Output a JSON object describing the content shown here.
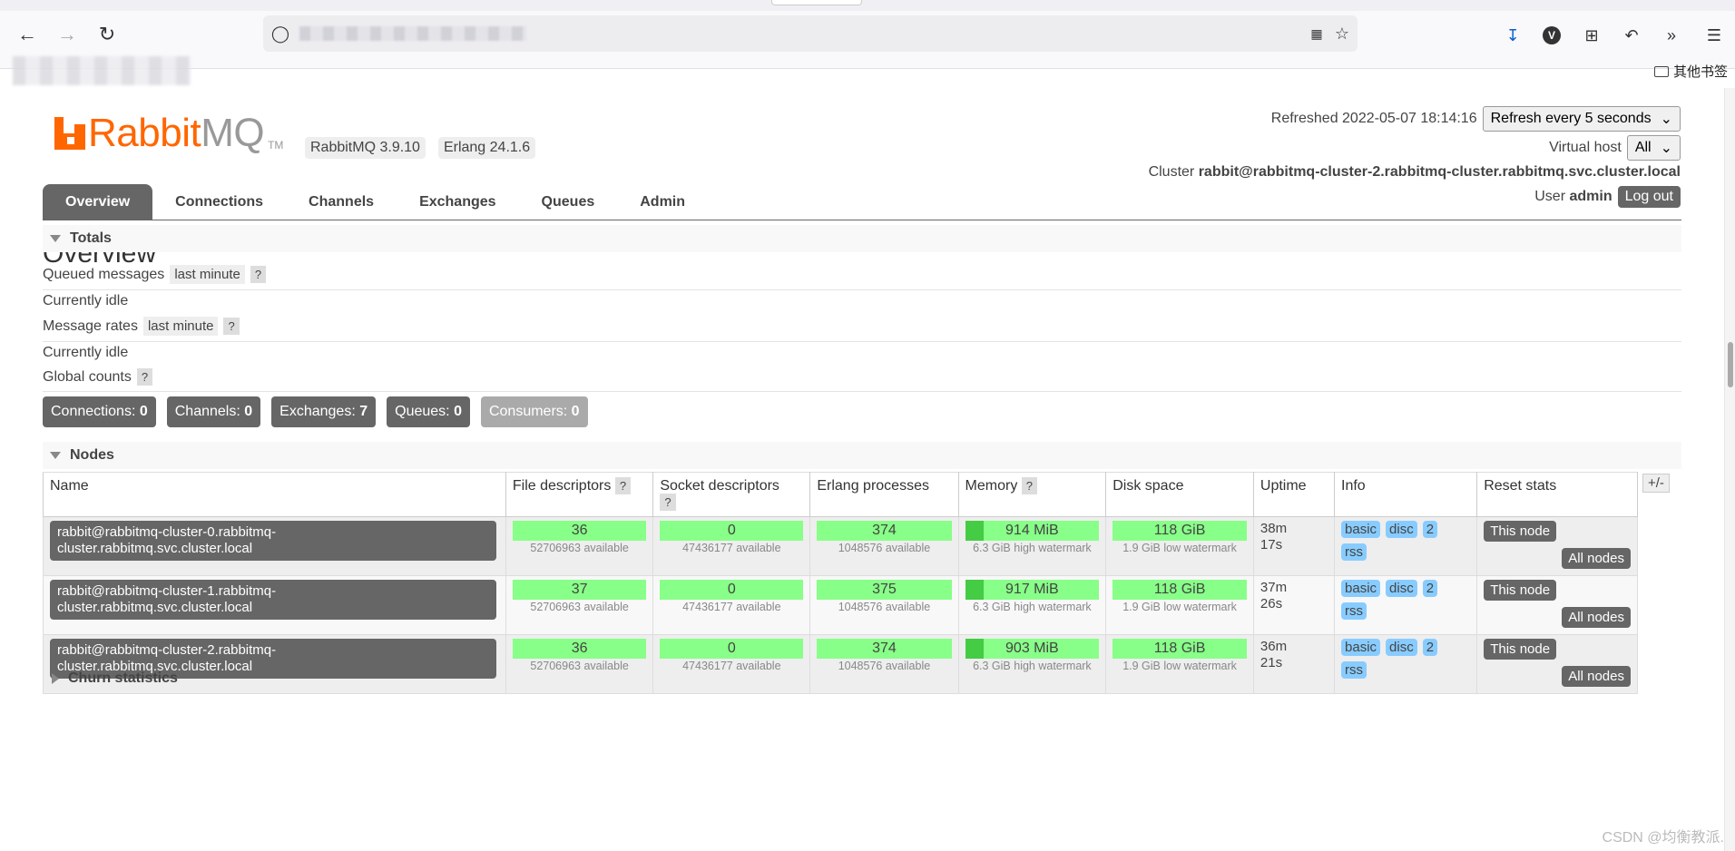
{
  "browser": {
    "bookmarks_other_label": "其他书签"
  },
  "header": {
    "logo_brand": "Rabbit",
    "logo_mq": "MQ",
    "logo_tm": "TM",
    "rabbitmq_version": "RabbitMQ 3.9.10",
    "erlang_version": "Erlang 24.1.6",
    "refreshed_label": "Refreshed 2022-05-07 18:14:16",
    "refresh_select_value": "Refresh every 5 seconds",
    "vhost_label": "Virtual host",
    "vhost_select_value": "All",
    "cluster_label": "Cluster",
    "cluster_name": "rabbit@rabbitmq-cluster-2.rabbitmq-cluster.rabbitmq.svc.cluster.local",
    "user_label": "User",
    "user_name": "admin",
    "logout_label": "Log out"
  },
  "tabs": [
    "Overview",
    "Connections",
    "Channels",
    "Exchanges",
    "Queues",
    "Admin"
  ],
  "page_title": "Overview",
  "totals": {
    "heading": "Totals",
    "queued_messages_label": "Queued messages",
    "queued_range": "last minute",
    "help": "?",
    "currently_idle_1": "Currently idle",
    "message_rates_label": "Message rates",
    "message_range": "last minute",
    "currently_idle_2": "Currently idle",
    "global_counts_label": "Global counts"
  },
  "counts": [
    {
      "label": "Connections:",
      "value": "0"
    },
    {
      "label": "Channels:",
      "value": "0"
    },
    {
      "label": "Exchanges:",
      "value": "7"
    },
    {
      "label": "Queues:",
      "value": "0"
    },
    {
      "label": "Consumers:",
      "value": "0"
    }
  ],
  "nodes": {
    "heading": "Nodes",
    "plus_minus": "+/-",
    "columns": [
      "Name",
      "File descriptors",
      "Socket descriptors",
      "Erlang processes",
      "Memory",
      "Disk space",
      "Uptime",
      "Info",
      "Reset stats"
    ],
    "rows": [
      {
        "name_line1": "rabbit@rabbitmq-cluster-0.rabbitmq-",
        "name_line2": "cluster.rabbitmq.svc.cluster.local",
        "fd": "36",
        "fd_avail": "52706963 available",
        "sd": "0",
        "sd_avail": "47436177 available",
        "ep": "374",
        "ep_avail": "1048576 available",
        "mem": "914 MiB",
        "mem_wm": "6.3 GiB high watermark",
        "mem_fraction": 0.14,
        "disk": "118 GiB",
        "disk_wm": "1.9 GiB low watermark",
        "uptime_1": "38m",
        "uptime_2": "17s",
        "info": [
          "basic",
          "disc",
          "2",
          "rss"
        ],
        "this_node": "This node",
        "all_nodes": "All nodes"
      },
      {
        "name_line1": "rabbit@rabbitmq-cluster-1.rabbitmq-",
        "name_line2": "cluster.rabbitmq.svc.cluster.local",
        "fd": "37",
        "fd_avail": "52706963 available",
        "sd": "0",
        "sd_avail": "47436177 available",
        "ep": "375",
        "ep_avail": "1048576 available",
        "mem": "917 MiB",
        "mem_wm": "6.3 GiB high watermark",
        "mem_fraction": 0.14,
        "disk": "118 GiB",
        "disk_wm": "1.9 GiB low watermark",
        "uptime_1": "37m",
        "uptime_2": "26s",
        "info": [
          "basic",
          "disc",
          "2",
          "rss"
        ],
        "this_node": "This node",
        "all_nodes": "All nodes"
      },
      {
        "name_line1": "rabbit@rabbitmq-cluster-2.rabbitmq-",
        "name_line2": "cluster.rabbitmq.svc.cluster.local",
        "fd": "36",
        "fd_avail": "52706963 available",
        "sd": "0",
        "sd_avail": "47436177 available",
        "ep": "374",
        "ep_avail": "1048576 available",
        "mem": "903 MiB",
        "mem_wm": "6.3 GiB high watermark",
        "mem_fraction": 0.14,
        "disk": "118 GiB",
        "disk_wm": "1.9 GiB low watermark",
        "uptime_1": "36m",
        "uptime_2": "21s",
        "info": [
          "basic",
          "disc",
          "2",
          "rss"
        ],
        "this_node": "This node",
        "all_nodes": "All nodes"
      }
    ]
  },
  "churn_heading": "Churn statistics",
  "watermark": "CSDN @均衡教派.",
  "colors": {
    "accent": "#ff6600",
    "bar_green": "#88ff88",
    "tag_blue": "#88ccff",
    "dark_button": "#666666"
  }
}
